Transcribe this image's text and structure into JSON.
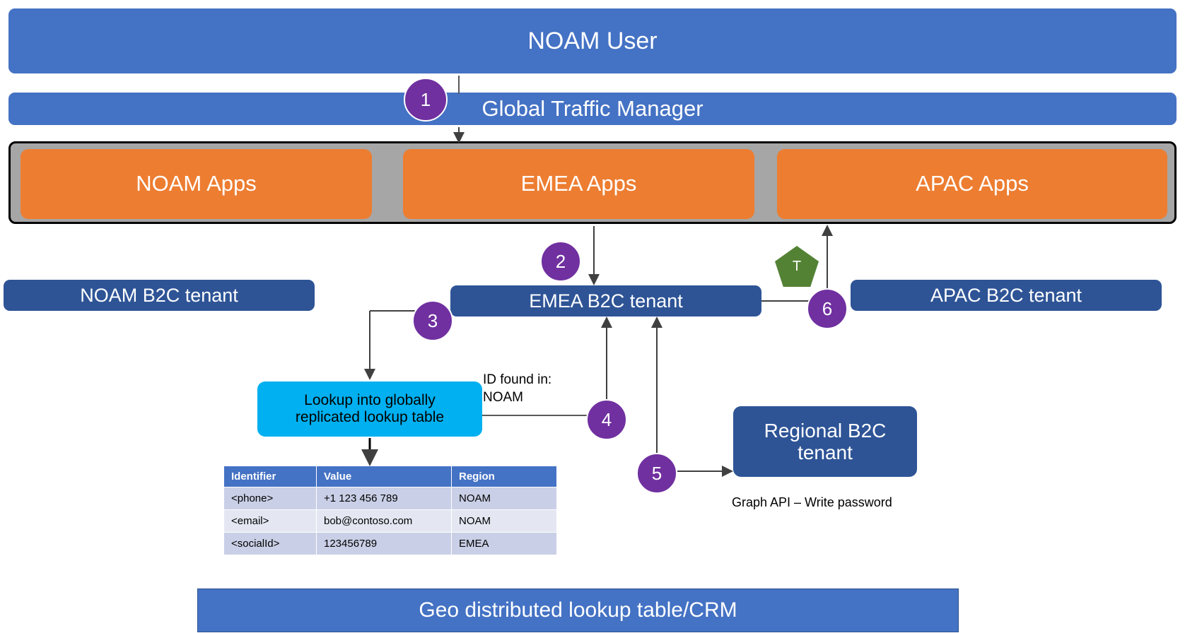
{
  "diagram": {
    "top": {
      "user_banner": "NOAM User",
      "traffic_manager": "Global Traffic Manager"
    },
    "apps": {
      "noam": "NOAM Apps",
      "emea": "EMEA Apps",
      "apac": "APAC Apps"
    },
    "tenants": {
      "noam": "NOAM B2C tenant",
      "emea": "EMEA B2C tenant",
      "apac": "APAC B2C tenant",
      "regional_line1": "Regional B2C",
      "regional_line2": "tenant"
    },
    "lookup": {
      "line1": "Lookup into globally",
      "line2": "replicated lookup table"
    },
    "captions": {
      "id_found_line1": "ID found in:",
      "id_found_line2": "NOAM",
      "graph_api": "Graph API – Write password"
    },
    "bottom_banner": "Geo distributed lookup table/CRM",
    "token_marker": "T",
    "steps": {
      "s1": "1",
      "s2": "2",
      "s3": "3",
      "s4": "4",
      "s5": "5",
      "s6": "6"
    },
    "colors": {
      "banner_blue": "#4472C4",
      "apps_orange": "#ED7D31",
      "container_gray": "#A6A6A6",
      "tenant_navy": "#2E5496",
      "lookup_cyan": "#00B0F0",
      "badge_purple": "#7030A0",
      "token_green": "#548235"
    }
  },
  "table": {
    "headers": [
      "Identifier",
      "Value",
      "Region"
    ],
    "rows": [
      [
        "<phone>",
        "+1 123 456 789",
        "NOAM"
      ],
      [
        "<email>",
        "bob@contoso.com",
        "NOAM"
      ],
      [
        "<socialId>",
        "123456789",
        "EMEA"
      ]
    ]
  }
}
